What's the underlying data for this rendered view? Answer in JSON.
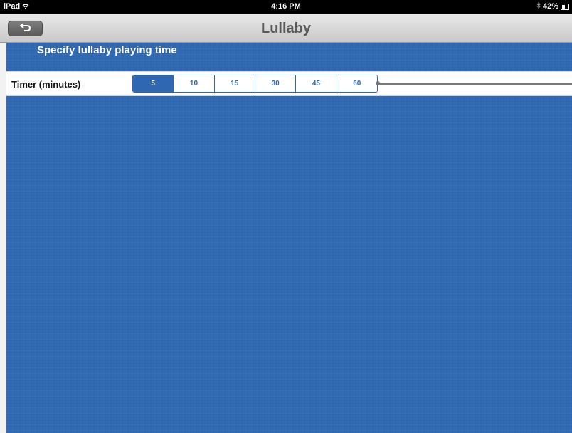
{
  "status_bar": {
    "carrier": "iPad",
    "wifi_icon": "wifi-icon",
    "time": "4:16 PM",
    "bluetooth_icon": "bluetooth-icon",
    "battery_percent": "42%",
    "battery_icon": "battery-icon"
  },
  "nav": {
    "title": "Lullaby",
    "back_icon": "back-arrow-icon"
  },
  "section": {
    "header": "Specify lullaby playing time"
  },
  "timer": {
    "label": "Timer (minutes)",
    "options": [
      "5",
      "10",
      "15",
      "30",
      "45",
      "60"
    ],
    "selected": "5"
  },
  "colors": {
    "accent": "#2f68b0",
    "nav_title": "#5a5a5a"
  }
}
